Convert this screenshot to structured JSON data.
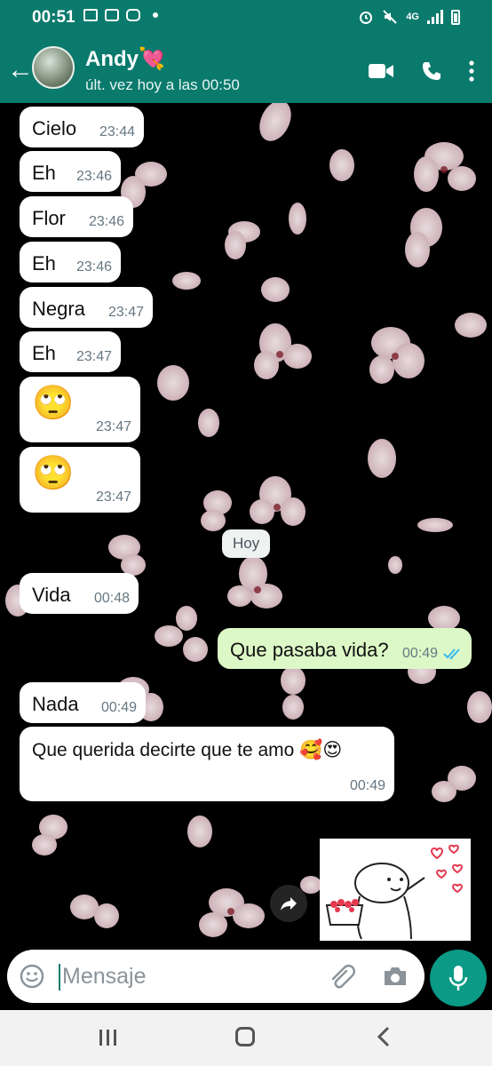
{
  "status_bar": {
    "time": "00:51",
    "network": "4G",
    "icons": [
      "image-icon",
      "dice-icon",
      "instagram-icon",
      "dot-icon",
      "alarm-icon",
      "mute-icon",
      "signal-icon",
      "battery-icon"
    ]
  },
  "header": {
    "contact_name": "Andy💘",
    "last_seen": "últ. vez hoy a las 00:50",
    "actions": [
      "video-call-icon",
      "call-icon",
      "more-icon"
    ]
  },
  "messages": [
    {
      "dir": "in",
      "text": "Cielo",
      "time": "23:44"
    },
    {
      "dir": "in",
      "text": "Eh",
      "time": "23:46"
    },
    {
      "dir": "in",
      "text": "Flor",
      "time": "23:46"
    },
    {
      "dir": "in",
      "text": "Eh",
      "time": "23:46"
    },
    {
      "dir": "in",
      "text": "Negra",
      "time": "23:47"
    },
    {
      "dir": "in",
      "text": "Eh",
      "time": "23:47"
    },
    {
      "dir": "in",
      "text": "🙄",
      "time": "23:47"
    },
    {
      "dir": "in",
      "text": "🙄",
      "time": "23:47"
    },
    {
      "dir": "in",
      "text": "Vida",
      "time": "00:48"
    },
    {
      "dir": "out",
      "text": "Que pasaba vida?",
      "time": "00:49",
      "status": "read"
    },
    {
      "dir": "in",
      "text": "Nada",
      "time": "00:49"
    },
    {
      "dir": "in",
      "text": "Que querida decirte que te amo 🥰😍",
      "time": "00:49"
    }
  ],
  "day_separator": "Hoy",
  "sticker": {
    "kind": "flork-with-hearts",
    "icon": "sticker-image"
  },
  "composer": {
    "placeholder": "Mensaje",
    "value": "",
    "icons": [
      "emoji-icon",
      "attach-icon",
      "camera-icon",
      "mic-icon"
    ]
  },
  "navbar": {
    "icons": [
      "recent-apps-icon",
      "home-icon",
      "back-icon"
    ]
  },
  "colors": {
    "header": "#0a7a6d",
    "incoming": "#ffffff",
    "outgoing": "#dcf8c6",
    "read_ticks": "#34b7f1",
    "mic_button": "#0a9a86"
  }
}
